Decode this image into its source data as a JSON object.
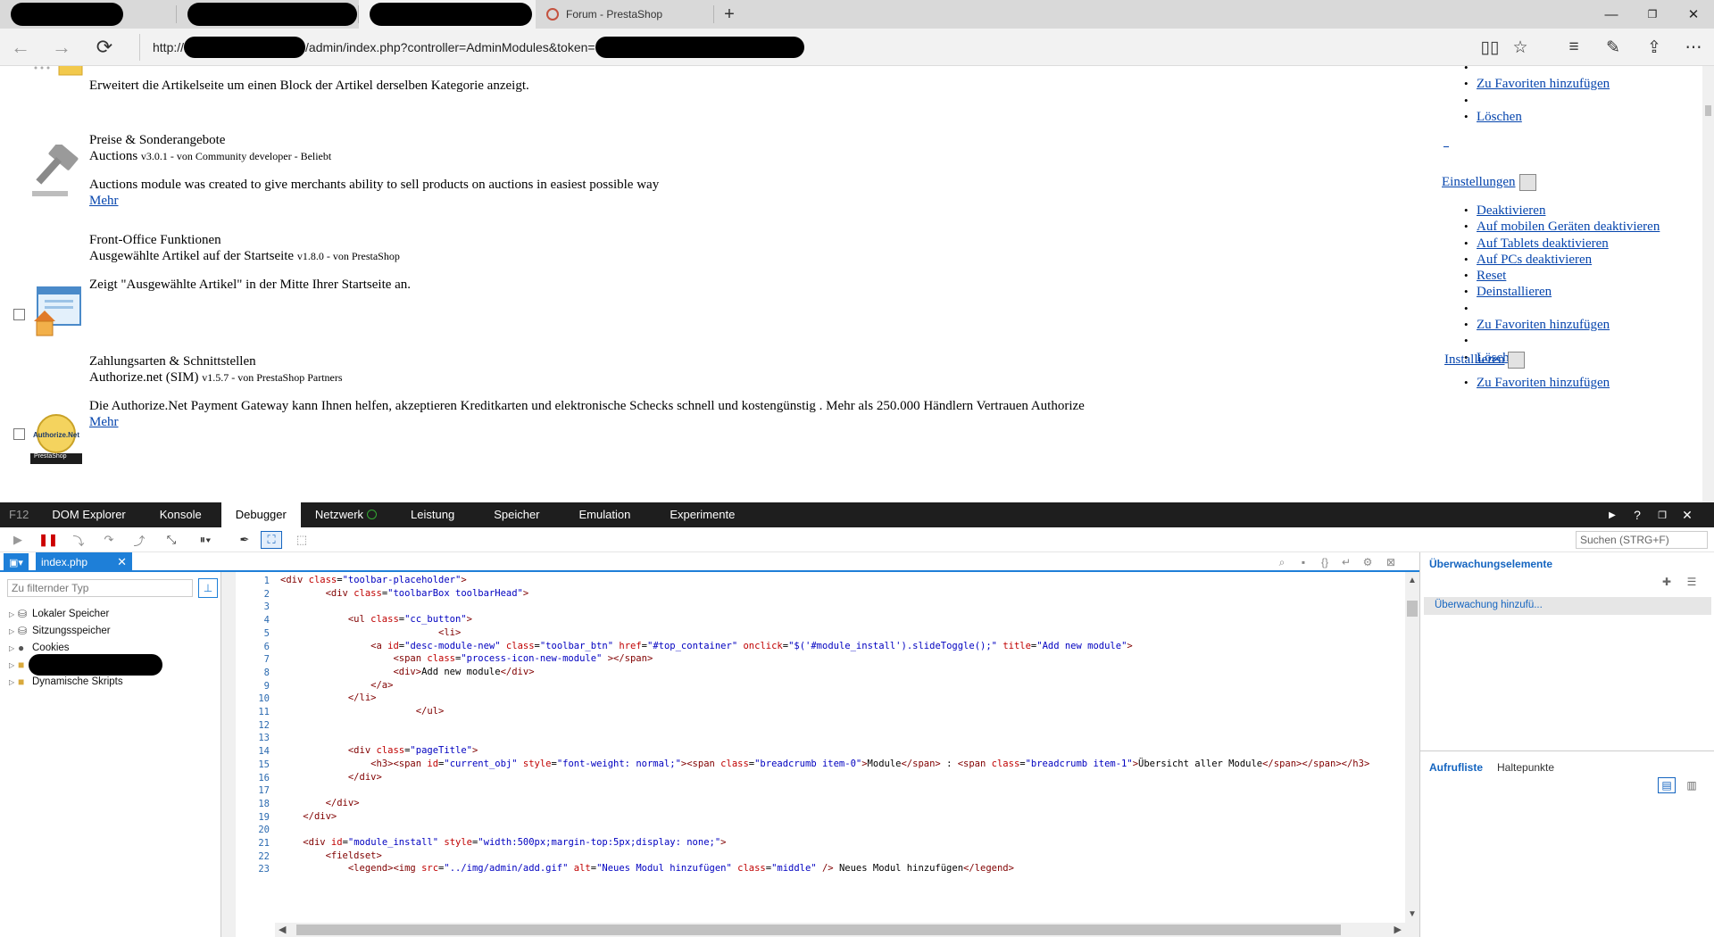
{
  "browser": {
    "tabs": [
      {
        "label": "",
        "redacted": true
      },
      {
        "label": "",
        "redacted": true
      },
      {
        "label": "",
        "redacted": true,
        "active": true
      },
      {
        "label": "Forum - PrestaShop"
      }
    ],
    "new_tab_icon": "plus-icon",
    "window_controls": {
      "minimize": "—",
      "restore": "❐",
      "close": "✕"
    },
    "url": {
      "prefix": "http://",
      "middle": "/admin/index.php?controller=AdminModules&token="
    },
    "icons": [
      "back-arrow-icon",
      "forward-arrow-icon",
      "refresh-icon",
      "reading-view-icon",
      "favorite-star-icon",
      "hub-icon",
      "web-note-icon",
      "share-icon",
      "more-icon"
    ]
  },
  "page": {
    "top_desc": "Erweitert die Artikelseite um einen Block der Artikel derselben Kategorie anzeigt.",
    "modules": [
      {
        "category": "Preise & Sonderangebote",
        "name": "Auctions",
        "meta": "v3.0.1 - von Community developer - Beliebt",
        "description": "Auctions module was created to give merchants ability to sell products on auctions in easiest possible way",
        "more": "Mehr"
      },
      {
        "category": "Front-Office Funktionen",
        "name": "Ausgewählte Artikel auf der Startseite",
        "meta": "v1.8.0 - von PrestaShop",
        "description": "Zeigt \"Ausgewählte Artikel\" in der Mitte Ihrer Startseite an."
      },
      {
        "category": "Zahlungsarten & Schnittstellen",
        "name": "Authorize.net (SIM)",
        "meta": "v1.5.7 - von PrestaShop Partners",
        "description": "Die Authorize.Net Payment Gateway kann Ihnen helfen, akzeptieren Kreditkarten und elektronische Schecks schnell und kostengünstig . Mehr als 250.000 Händlern Vertrauen Authorize",
        "more": "Mehr",
        "logo_text": "Authorize.Net",
        "logo_sub": "PrestaShop"
      }
    ],
    "actions_top": [
      "",
      "Zu Favoriten hinzufügen",
      "",
      "Löschen"
    ],
    "underscore_link": "_",
    "settings_label": "Einstellungen",
    "actions_mid": [
      "Deaktivieren",
      "Auf mobilen Geräten deaktivieren",
      "Auf Tablets deaktivieren",
      "Auf PCs deaktivieren",
      "Reset",
      "Deinstallieren",
      "",
      "Zu Favoriten hinzufügen",
      "",
      "Löschen"
    ],
    "install_label": "Installieren",
    "actions_bottom": [
      "Zu Favoriten hinzufügen"
    ]
  },
  "devtools": {
    "tabs": [
      "F12",
      "DOM Explorer",
      "Konsole",
      "Debugger",
      "Netzwerk",
      "Leistung",
      "Speicher",
      "Emulation",
      "Experimente"
    ],
    "active_tab": "Debugger",
    "window_buttons": [
      "▶",
      "?",
      "❐",
      "✕"
    ],
    "search_placeholder": "Suchen (STRG+F)",
    "file_tab": "index.php",
    "filter_placeholder": "Zu filternder Typ",
    "tree": [
      "Lokaler Speicher",
      "Sitzungsspeicher",
      "Cookies",
      "",
      "Dynamische Skripts"
    ],
    "watch_title": "Überwachungselemente",
    "watch_add": "Überwachung hinzufü...",
    "callstack_tab": "Aufrufliste",
    "breakpoints_tab": "Haltepunkte",
    "code_lines": [
      {
        "n": "1",
        "text": "<div class=\"toolbar-placeholder\">"
      },
      {
        "n": "2",
        "text": "        <div class=\"toolbarBox toolbarHead\">"
      },
      {
        "n": "3",
        "text": ""
      },
      {
        "n": "4",
        "text": "            <ul class=\"cc_button\">"
      },
      {
        "n": "5",
        "text": "                            <li>"
      },
      {
        "n": "6",
        "text": "                <a id=\"desc-module-new\" class=\"toolbar_btn\" href=\"#top_container\" onclick=\"$('#module_install').slideToggle();\" title=\"Add new module\">"
      },
      {
        "n": "7",
        "text": "                    <span class=\"process-icon-new-module\" ></span>"
      },
      {
        "n": "8",
        "text": "                    <div>Add new module</div>"
      },
      {
        "n": "9",
        "text": "                </a>"
      },
      {
        "n": "10",
        "text": "            </li>"
      },
      {
        "n": "11",
        "text": "                        </ul>"
      },
      {
        "n": "12",
        "text": ""
      },
      {
        "n": "13",
        "text": ""
      },
      {
        "n": "14",
        "text": "            <div class=\"pageTitle\">"
      },
      {
        "n": "15",
        "text": "                <h3><span id=\"current_obj\" style=\"font-weight: normal;\"><span class=\"breadcrumb item-0\">Module</span> : <span class=\"breadcrumb item-1\">Übersicht aller Module</span></span></h3>"
      },
      {
        "n": "16",
        "text": "            </div>"
      },
      {
        "n": "17",
        "text": ""
      },
      {
        "n": "18",
        "text": "        </div>"
      },
      {
        "n": "19",
        "text": "    </div>"
      },
      {
        "n": "20",
        "text": ""
      },
      {
        "n": "21",
        "text": "    <div id=\"module_install\" style=\"width:500px;margin-top:5px;display: none;\">"
      },
      {
        "n": "22",
        "text": "        <fieldset>"
      },
      {
        "n": "23",
        "text": "            <legend><img src=\"../img/admin/add.gif\" alt=\"Neues Modul hinzufügen\" class=\"middle\" /> Neues Modul hinzufügen</legend>"
      }
    ]
  }
}
